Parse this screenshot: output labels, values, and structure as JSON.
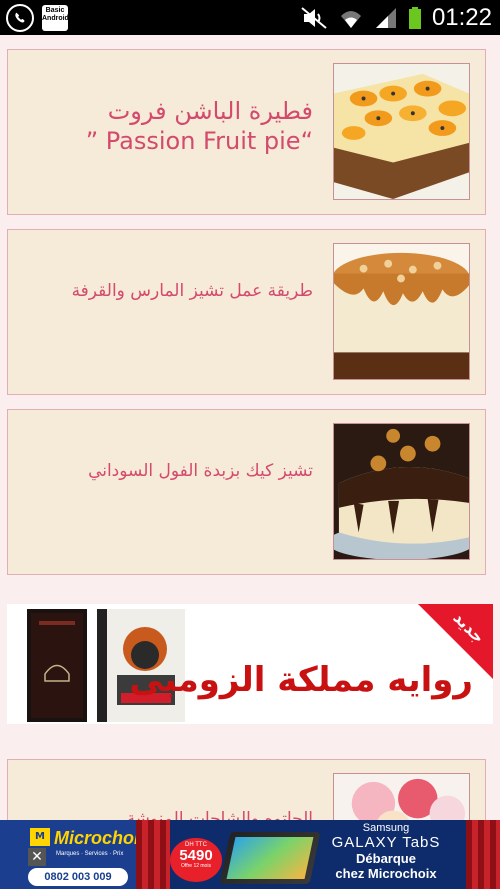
{
  "statusbar": {
    "time": "01:22",
    "notification_icons": [
      "whatsapp-icon",
      "basic-android-icon"
    ],
    "basic_icon_text": [
      "Basic",
      "Android"
    ],
    "system_icons": [
      "mute-icon",
      "wifi-icon",
      "signal-icon",
      "battery-icon"
    ]
  },
  "recipes": [
    {
      "title": "فطيرة الباشن فروت “Passion Fruit pie ”",
      "image": "passion-fruit-pie"
    },
    {
      "title": "طريقة عمل تشيز المارس والقرفة",
      "image": "mars-cheesecake"
    },
    {
      "title": "تشيز كيك بزبدة الفول السوداني",
      "image": "peanut-butter-cheesecake"
    },
    {
      "title": "الجاتوه والشاحات المنوشة",
      "image": "ice-cream-cake"
    }
  ],
  "banner": {
    "badge": "جديد",
    "headline": "روايه مملكة الزومبى"
  },
  "ad": {
    "brand": "Microchoix",
    "tagline": "Marques · Services · Prix",
    "phone": "0802 003 009",
    "price_prefix": "DH TTC",
    "price": "5490",
    "price_note": "Offre 12 mois",
    "line1": "Samsung",
    "line2": "GALAXY TabS",
    "line3": "Débarque",
    "line4": "chez Microchoix",
    "close": "✕"
  },
  "colors": {
    "card_bg": "#f5ebd8",
    "card_border": "#e0aeb3",
    "title": "#d44a6d",
    "page_bg": "#faeeee"
  }
}
